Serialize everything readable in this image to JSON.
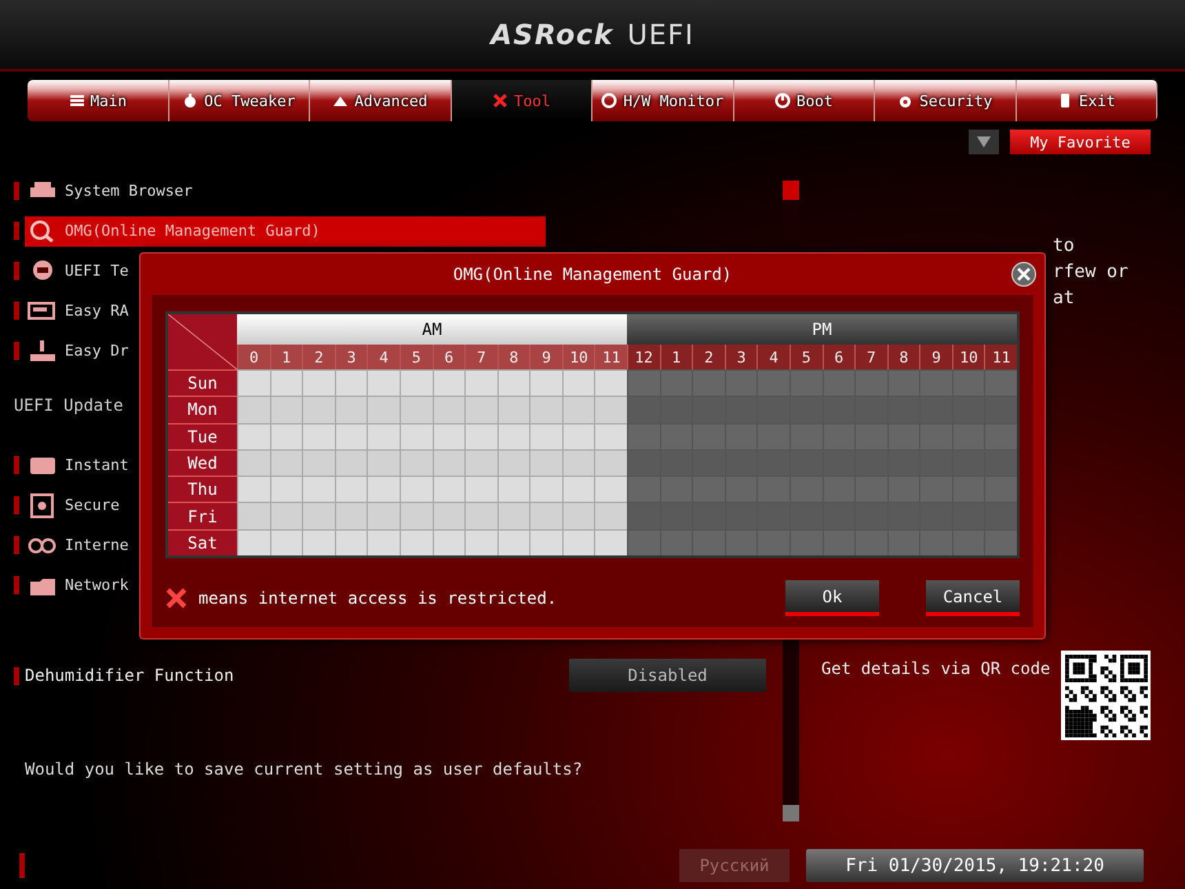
{
  "header": {
    "brand": "ASRock",
    "product": "UEFI"
  },
  "tabs": [
    {
      "label": "Main",
      "selected": false
    },
    {
      "label": "OC Tweaker",
      "selected": false
    },
    {
      "label": "Advanced",
      "selected": false
    },
    {
      "label": "Tool",
      "selected": true
    },
    {
      "label": "H/W Monitor",
      "selected": false
    },
    {
      "label": "Boot",
      "selected": false
    },
    {
      "label": "Security",
      "selected": false
    },
    {
      "label": "Exit",
      "selected": false
    }
  ],
  "favorite": {
    "label": "My Favorite"
  },
  "menu": [
    {
      "kind": "item",
      "label": "System Browser",
      "selected": false
    },
    {
      "kind": "item",
      "label": "OMG(Online Management Guard)",
      "selected": true
    },
    {
      "kind": "item",
      "label": "UEFI Te",
      "selected": false
    },
    {
      "kind": "item",
      "label": "Easy RA",
      "selected": false
    },
    {
      "kind": "item",
      "label": "Easy Dr",
      "selected": false
    },
    {
      "kind": "section",
      "label": "UEFI Update"
    },
    {
      "kind": "item",
      "label": "Instant",
      "selected": false
    },
    {
      "kind": "item",
      "label": "Secure",
      "selected": false
    },
    {
      "kind": "item",
      "label": "Interne",
      "selected": false
    },
    {
      "kind": "item",
      "label": "Network",
      "selected": false
    }
  ],
  "setting": {
    "label": "Dehumidifier Function",
    "value": "Disabled"
  },
  "prompt": "Would you like to save current setting as user defaults?",
  "description": {
    "lines": [
      "to",
      "rfew or",
      "at"
    ]
  },
  "qr": {
    "label": "Get details via QR code"
  },
  "language": {
    "label": "Русский",
    "disabled": true
  },
  "datetime": "Fri 01/30/2015, 19:21:20",
  "dialog": {
    "title": "OMG(Online Management Guard)",
    "am_label": "AM",
    "pm_label": "PM",
    "hours": [
      "0",
      "1",
      "2",
      "3",
      "4",
      "5",
      "6",
      "7",
      "8",
      "9",
      "10",
      "11",
      "12",
      "1",
      "2",
      "3",
      "4",
      "5",
      "6",
      "7",
      "8",
      "9",
      "10",
      "11"
    ],
    "days": [
      "Sun",
      "Mon",
      "Tue",
      "Wed",
      "Thu",
      "Fri",
      "Sat"
    ],
    "legend": "means internet access is restricted.",
    "buttons": [
      {
        "label": "Ok"
      },
      {
        "label": "Cancel"
      }
    ]
  }
}
